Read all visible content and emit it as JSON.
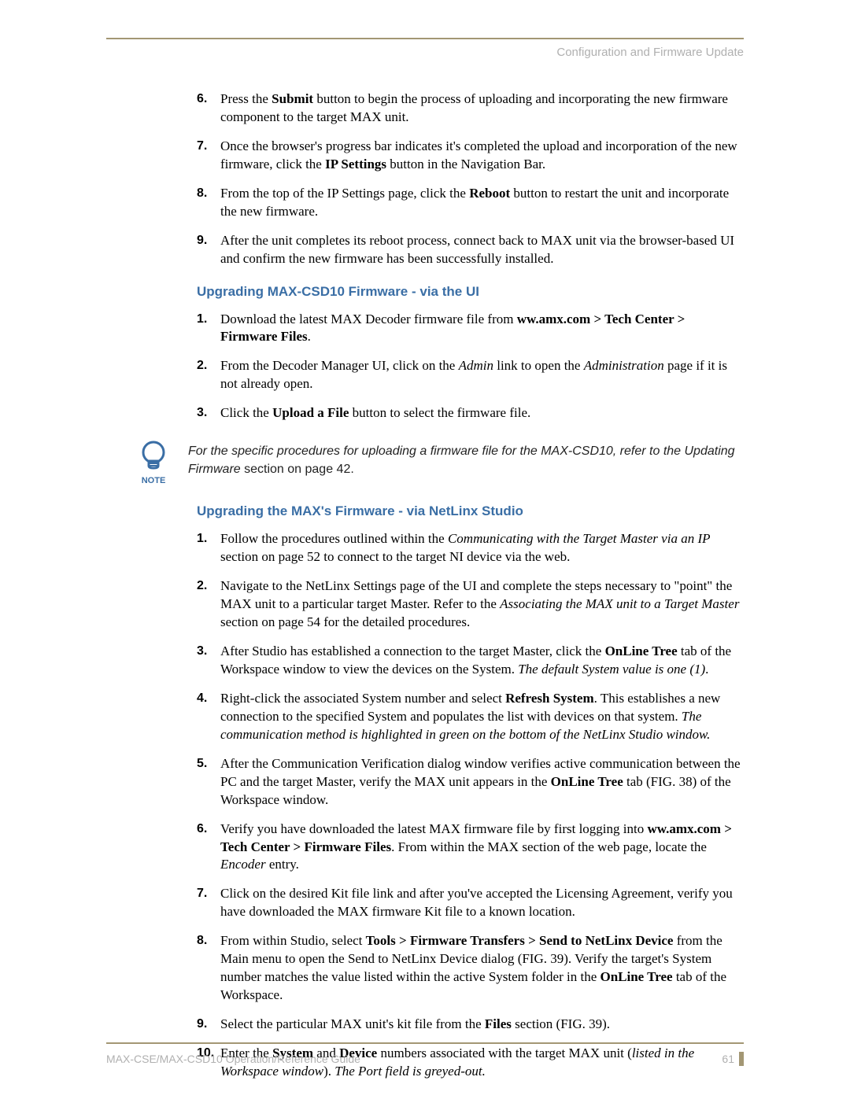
{
  "header": {
    "section_title": "Configuration and Firmware Update"
  },
  "list1": {
    "prefix": [
      "6.",
      "7.",
      "8.",
      "9."
    ],
    "items": [
      {
        "pre": "Press the ",
        "b1": "Submit",
        "post1": " button to begin the process of uploading and incorporating the new firmware component to the target MAX unit."
      },
      {
        "pre": "Once the browser's progress bar indicates it's completed the upload and incorporation of the new firmware, click the ",
        "b1": "IP Settings",
        "post1": " button in the Navigation Bar."
      },
      {
        "pre": "From the top of the IP Settings page, click the ",
        "b1": "Reboot",
        "post1": " button to restart the unit and incorporate the new firmware."
      },
      {
        "pre": "After the unit completes its reboot process, connect back to MAX unit via the browser-based UI and confirm the new firmware has been successfully installed."
      }
    ]
  },
  "heading1": "Upgrading MAX-CSD10 Firmware - via the UI",
  "list2": {
    "prefix": [
      "1.",
      "2.",
      "3."
    ],
    "items": [
      {
        "pre": "Download the latest MAX Decoder firmware file from ",
        "b1": "ww.amx.com > Tech Center > Firmware Files",
        "post1": "."
      },
      {
        "pre": "From the Decoder Manager UI, click on the ",
        "i1": "Admin",
        "mid1": " link to open the ",
        "i2": "Administration",
        "post1": " page if it is not already open."
      },
      {
        "pre": "Click the ",
        "b1": "Upload a File",
        "post1": " button to select the firmware file."
      }
    ]
  },
  "note": {
    "label": "NOTE",
    "line1": "For the specific procedures for uploading a firmware file for the MAX-CSD10, refer to the Updating Firmware",
    "line2_plain": " section on page 42."
  },
  "heading2": "Upgrading the MAX's Firmware - via NetLinx Studio",
  "list3": {
    "prefix": [
      "1.",
      "2.",
      "3.",
      "4.",
      "5.",
      "6.",
      "7.",
      "8.",
      "9.",
      "10."
    ],
    "items": [
      {
        "pre": "Follow the procedures outlined within the ",
        "i1": "Communicating with the Target Master via an IP",
        "post1": " section on page 52 to connect to the target NI device via the web."
      },
      {
        "pre": "Navigate to the NetLinx Settings page of the UI and complete the steps necessary to \"point\" the MAX unit to a particular target Master. Refer to the ",
        "i1": "Associating the MAX unit to a Target Master",
        "post1": " section on page 54 for the detailed procedures."
      },
      {
        "pre": "After Studio has established a connection to the target Master, click the ",
        "b1": "OnLine Tree",
        "mid1": " tab of the Workspace window to view the devices on the System. ",
        "i1": "The default System value is one (1)",
        "post1": "."
      },
      {
        "pre": "Right-click the associated System number and select ",
        "b1": "Refresh System",
        "mid1": ". This establishes a new connection to the specified System and populates the list with devices on that system. ",
        "i1": "The communication method is highlighted in green on the bottom of the NetLinx Studio window."
      },
      {
        "pre": "After the Communication Verification dialog window verifies active communication between the PC and the target Master, verify the MAX unit appears in the ",
        "b1": "OnLine Tree",
        "post1": " tab (FIG. 38) of the Workspace window."
      },
      {
        "pre": "Verify you have downloaded the latest MAX firmware file by first logging into ",
        "b1": "ww.amx.com > Tech Center > Firmware Files",
        "mid1": ". From within the MAX section of the web page, locate the ",
        "i1": "Encoder",
        "post1": " entry."
      },
      {
        "pre": "Click on the desired Kit file link and after you've accepted the Licensing Agreement, verify you have downloaded the MAX firmware Kit file to a known location."
      },
      {
        "pre": "From within Studio, select ",
        "b1": "Tools > Firmware Transfers > Send to NetLinx Device",
        "mid1": " from the Main menu to open the Send to NetLinx Device dialog (FIG. 39). Verify the target's System number matches the value listed within the active System folder in the ",
        "b2": "OnLine Tree",
        "post1": " tab of the Workspace."
      },
      {
        "pre": "Select the particular MAX unit's kit file from the ",
        "b1": "Files",
        "post1": " section (FIG. 39)."
      },
      {
        "pre": "Enter the ",
        "b1": "System",
        "mid1": " and ",
        "b2": "Device",
        "mid2": " numbers associated with the target MAX unit (",
        "i1": "listed in the Workspace window",
        "mid3": "). ",
        "i2": "The Port field is greyed-out."
      }
    ]
  },
  "footer": {
    "doc_title": "MAX-CSE/MAX-CSD10 Operation/Reference Guide",
    "page_number": "61"
  }
}
